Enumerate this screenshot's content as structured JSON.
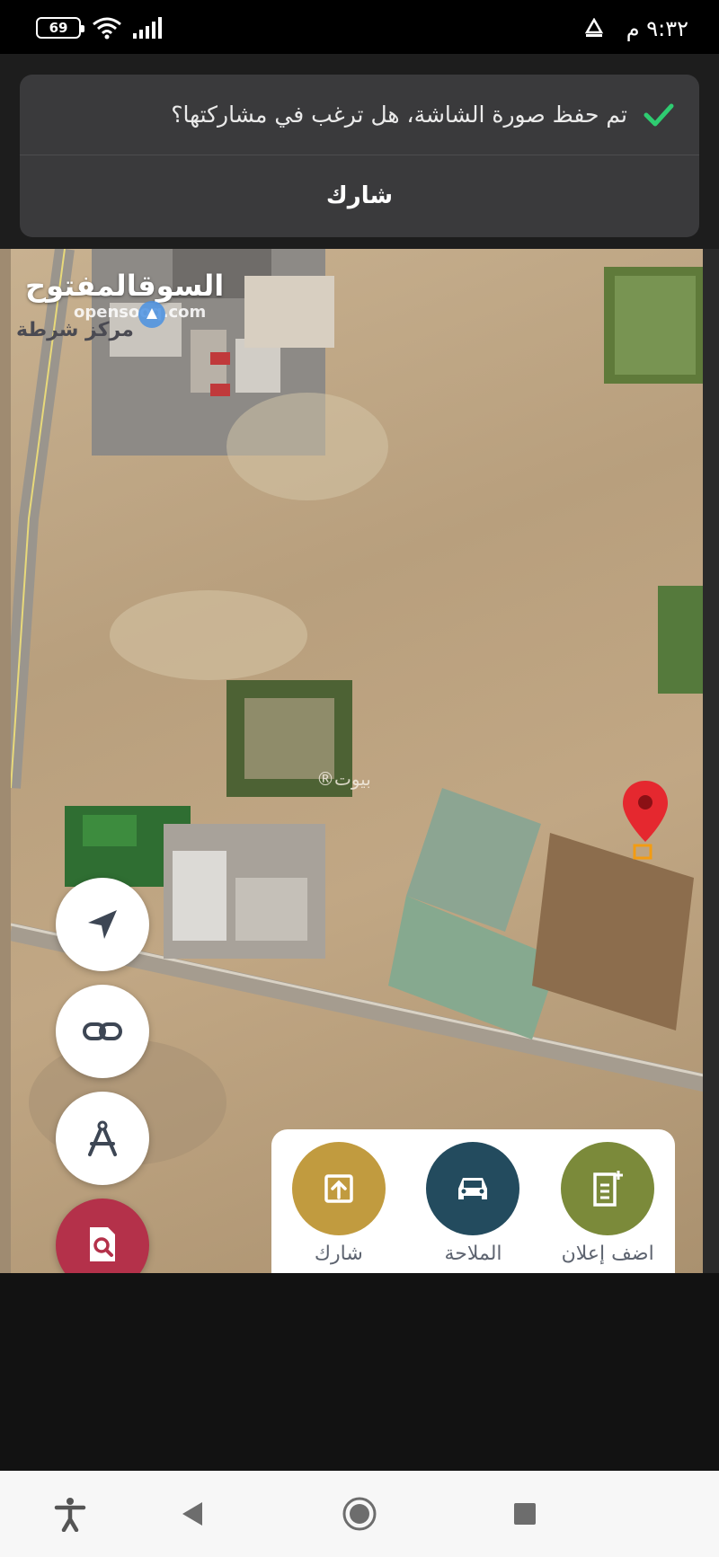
{
  "status": {
    "time": "٩:٣٢ م",
    "battery": "69"
  },
  "toast": {
    "message": "تم حفظ صورة الشاشة، هل ترغب في مشاركتها؟",
    "action": "شارك"
  },
  "map": {
    "watermark_ar": "السوقالمفتوح",
    "watermark_en": "opensooq.com",
    "poi_label": "مركز شرطة",
    "watermark2": "بيوت®"
  },
  "actions": [
    {
      "label": "اضف إعلان",
      "color": "#7b8a3a",
      "icon": "add-listing-icon"
    },
    {
      "label": "الملاحة",
      "color": "#234b5e",
      "icon": "car-icon"
    },
    {
      "label": "شارك",
      "color": "#c19b3f",
      "icon": "share-icon"
    }
  ],
  "colors": {
    "toast_bg": "#3a3a3c",
    "check": "#2ecc71",
    "pin": "#e5282f",
    "fab_red": "#b4314a"
  }
}
